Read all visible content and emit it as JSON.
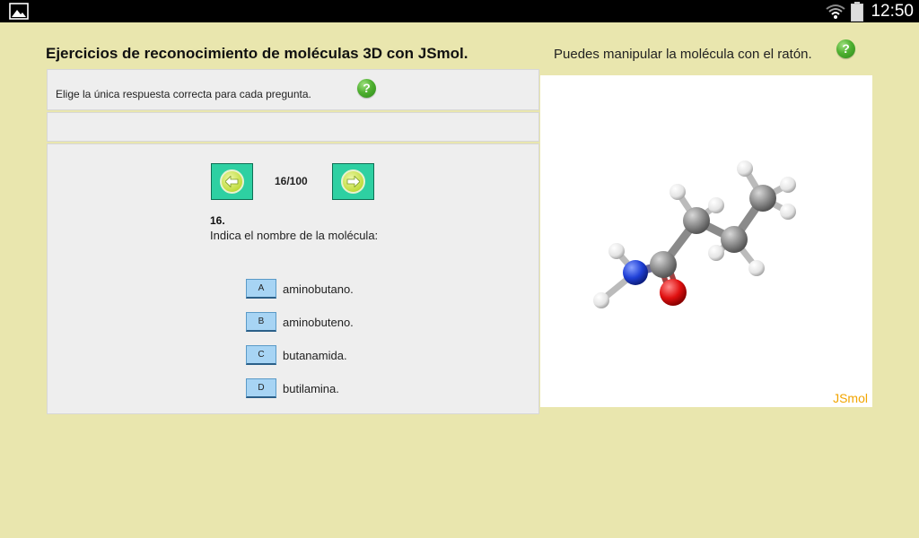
{
  "status_bar": {
    "clock": "12:50",
    "left_icon": "gallery-icon",
    "right_icons": [
      "wifi-icon",
      "battery-icon"
    ]
  },
  "page": {
    "title": "Ejercicios de reconocimiento de moléculas 3D con JSmol."
  },
  "instructions": {
    "text": "Elige la única respuesta correcta para cada pregunta.",
    "help_icon": "?"
  },
  "navigation": {
    "counter": "16/100",
    "current": 16,
    "total": 100,
    "prev_icon": "arrow-left-icon",
    "next_icon": "arrow-right-icon"
  },
  "question": {
    "number": "16.",
    "text": "Indica el nombre de la molécula:"
  },
  "options": [
    {
      "letter": "A",
      "text": "aminobutano."
    },
    {
      "letter": "B",
      "text": "aminobuteno."
    },
    {
      "letter": "C",
      "text": "butanamida."
    },
    {
      "letter": "D",
      "text": "butilamina."
    }
  ],
  "viewer": {
    "caption": "Puedes manipular la molécula con el ratón.",
    "help_icon": "?",
    "watermark": "JSmol"
  },
  "colors": {
    "background": "#e9e6ae",
    "nav_button": "#2ed0a2",
    "option_button": "#a7d4f4",
    "carbon": "#8a8a8a",
    "hydrogen": "#f2f2f2",
    "nitrogen": "#1f3fd6",
    "oxygen": "#e01010",
    "jsmol_label": "#f2a500"
  }
}
